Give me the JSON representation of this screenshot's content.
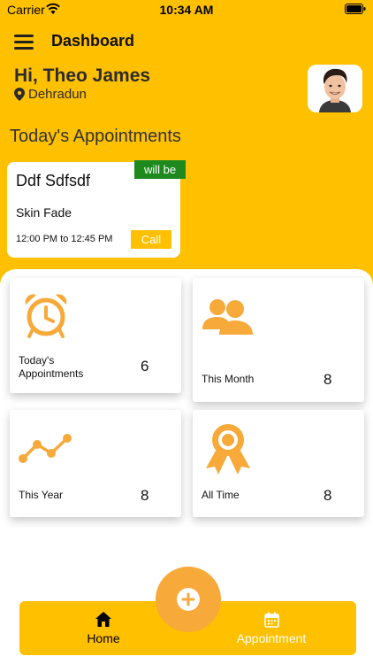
{
  "status_bar": {
    "carrier": "Carrier",
    "time": "10:34 AM"
  },
  "nav": {
    "title": "Dashboard"
  },
  "user": {
    "greeting": "Hi, Theo James",
    "location": "Dehradun"
  },
  "section_title": "Today's Appointments",
  "appointment": {
    "badge": "will be",
    "name": "Ddf Sdfsdf",
    "service": "Skin Fade",
    "time": "12:00 PM to 12:45 PM",
    "call_label": "Call"
  },
  "stats": [
    {
      "label_line1": "Today's",
      "label_line2": "Appointments",
      "value": "6",
      "icon": "alarm-clock-icon"
    },
    {
      "label": "This Month",
      "value": "8",
      "icon": "users-icon"
    },
    {
      "label": "This Year",
      "value": "8",
      "icon": "trend-line-icon"
    },
    {
      "label": "All Time",
      "value": "8",
      "icon": "award-ribbon-icon"
    }
  ],
  "bottom_nav": {
    "home_label": "Home",
    "appointment_label": "Appointment"
  },
  "colors": {
    "primary": "#FFC000",
    "accent_orange": "#F7A93A",
    "badge_green": "#1E8A1E"
  }
}
